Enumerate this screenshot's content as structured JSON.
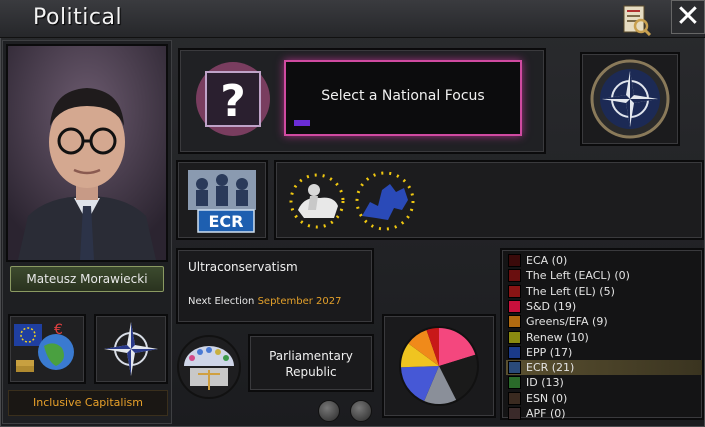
{
  "window": {
    "title": "Political"
  },
  "leader": {
    "name": "Mateusz Morawiecki"
  },
  "focus": {
    "label": "Select a National Focus"
  },
  "ruling_party": {
    "badge": "ECR"
  },
  "ideology": {
    "name": "Ultraconservatism",
    "election_prefix": "Next Election",
    "election_date": "September 2027"
  },
  "government": {
    "type": "Parliamentary Republic"
  },
  "economy": {
    "label": "Inclusive Capitalism"
  },
  "parties": [
    {
      "label": "ECA (0)",
      "color": "#3a0a0a",
      "selected": false
    },
    {
      "label": "The Left (EACL) (0)",
      "color": "#6a0f0f",
      "selected": false
    },
    {
      "label": "The Left (EL) (5)",
      "color": "#8a1414",
      "selected": false
    },
    {
      "label": "S&D (19)",
      "color": "#c8103c",
      "selected": false
    },
    {
      "label": "Greens/EFA (9)",
      "color": "#b06a10",
      "selected": false
    },
    {
      "label": "Renew (10)",
      "color": "#8a8a10",
      "selected": false
    },
    {
      "label": "EPP (17)",
      "color": "#1a3a8a",
      "selected": false
    },
    {
      "label": "ECR (21)",
      "color": "#2a4a7a",
      "selected": true
    },
    {
      "label": "ID (13)",
      "color": "#2a6a2a",
      "selected": false
    },
    {
      "label": "ESN (0)",
      "color": "#3a2a20",
      "selected": false
    },
    {
      "label": "APF (0)",
      "color": "#3a2a2a",
      "selected": false
    }
  ],
  "pie": {
    "slices": [
      {
        "name": "S&D",
        "value": 19,
        "color": "#f4477e"
      },
      {
        "name": "ECR",
        "value": 21,
        "color": "#1a1a1a"
      },
      {
        "name": "ID",
        "value": 13,
        "color": "#8a8f99"
      },
      {
        "name": "EPP",
        "value": 17,
        "color": "#4658d6"
      },
      {
        "name": "Renew",
        "value": 10,
        "color": "#f0c420"
      },
      {
        "name": "Greens/EFA",
        "value": 9,
        "color": "#f08a1a"
      },
      {
        "name": "The Left (EL)",
        "value": 5,
        "color": "#c81818"
      }
    ]
  }
}
